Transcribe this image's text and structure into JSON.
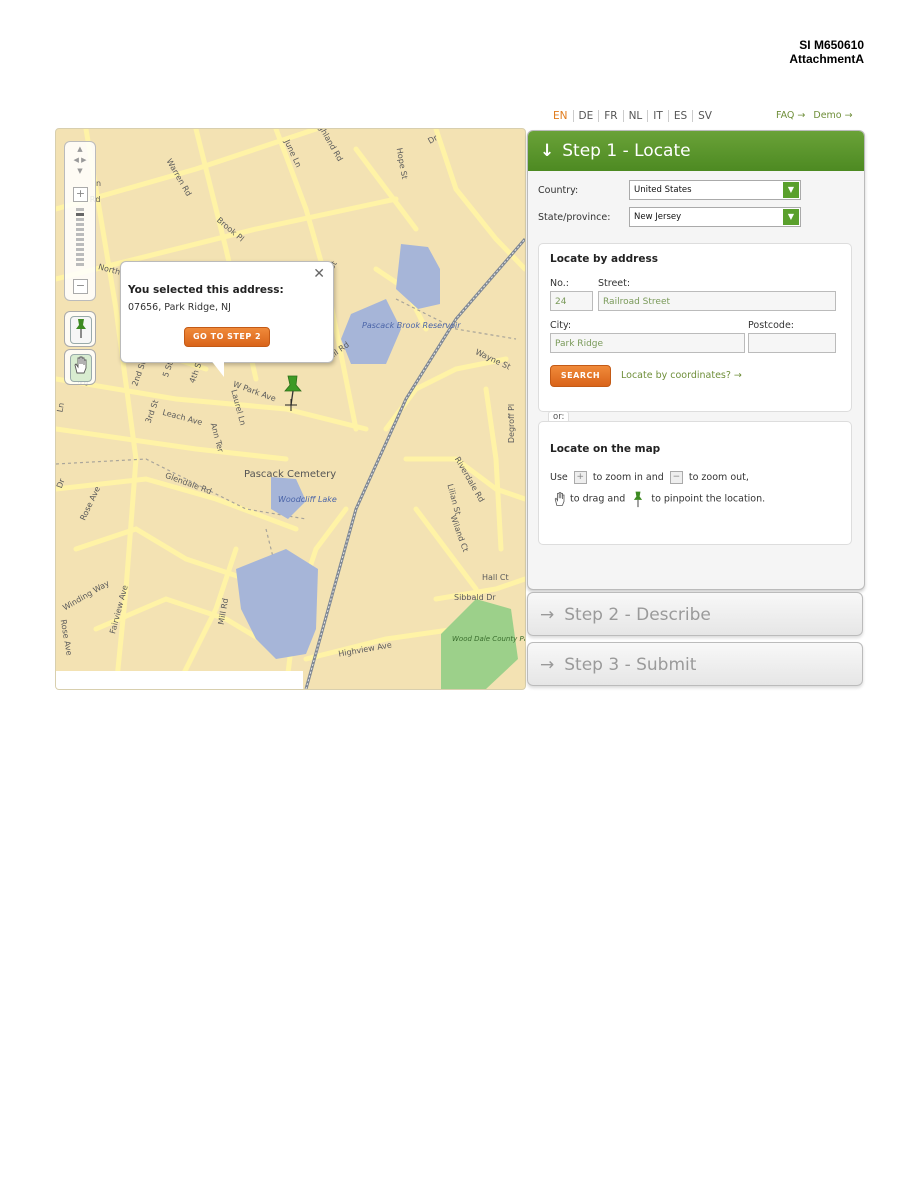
{
  "doc": {
    "code": "SI M650610",
    "attachment": "AttachmentA"
  },
  "languages": [
    {
      "code": "EN",
      "active": true
    },
    {
      "code": "DE"
    },
    {
      "code": "FR"
    },
    {
      "code": "NL"
    },
    {
      "code": "IT"
    },
    {
      "code": "ES"
    },
    {
      "code": "SV"
    }
  ],
  "links": {
    "faq": "FAQ →",
    "demo": "Demo →"
  },
  "map": {
    "popup": {
      "close": "✕",
      "title": "You selected this address:",
      "address": "07656, Park Ridge, NJ",
      "button": "GO TO STEP 2"
    },
    "labels": {
      "pascack_cemetery": "Pascack Cemetery",
      "pascack_brook_reservoir": "Pascack Brook Reservoir",
      "woodcliff_lake": "Woodcliff Lake",
      "wood_dale_park": "Wood Dale County Park Pond",
      "w_park_ave": "W Park Ave",
      "leach_ave": "Leach Ave",
      "glendale_rd": "Glendale Rd",
      "rose_ave": "Rose Ave",
      "winding_way": "Winding Way",
      "fairview_ave": "Fairview Ave",
      "mill_rd": "Mill Rd",
      "highview_ave": "Highview Ave",
      "sibbald_dr": "Sibbald Dr",
      "hall_ct": "Hall Ct",
      "riverdale_rd": "Riverdale Rd",
      "degroff_pl": "Degroff Pl",
      "wayne_st": "Wayne St",
      "hope_st": "Hope St",
      "warren_rd": "Warren Rd",
      "brook_pl": "Brook Pl",
      "ds_rd": "ds Rd",
      "north": "North",
      "june_ln": "June Ln",
      "highland_rd": "Highland Rd",
      "lilian_st": "Lilian St",
      "wiland_ct": "Wiland Ct",
      "ann_ter": "Ann Ter",
      "laurel_ln": "Laurel Ln",
      "third_st": "3rd St",
      "fourth_st": "4th St",
      "second_st": "2nd St",
      "fifth_st": "5 St",
      "ave_left": "Ave",
      "lin_st": "Lin St",
      "ln_left": "Ln",
      "dr_left": "Dr",
      "rose_ave_2": "Rose Ave",
      "n_left": "n",
      "dr_top": "Dr"
    }
  },
  "step1": {
    "heading": "Step 1 - Locate",
    "arrow": "↓",
    "country_label": "Country:",
    "country_value": "United States",
    "state_label": "State/province:",
    "state_value": "New Jersey",
    "by_address": {
      "title": "Locate by address",
      "no_label": "No.:",
      "no_value": "24",
      "street_label": "Street:",
      "street_value": "Railroad Street",
      "city_label": "City:",
      "city_value": "Park Ridge",
      "postcode_label": "Postcode:",
      "postcode_value": "",
      "search": "SEARCH",
      "coords_link": "Locate by coordinates? →"
    },
    "or": "or:",
    "on_map": {
      "title": "Locate on the map",
      "use": "Use",
      "zoom_in_text": "to zoom in and",
      "zoom_out_text": "to zoom out,",
      "drag_text": "to drag and",
      "pin_text": "to pinpoint the location."
    }
  },
  "step2": {
    "heading": "Step 2 - Describe",
    "arrow": "→"
  },
  "step3": {
    "heading": "Step 3 - Submit",
    "arrow": "→"
  }
}
